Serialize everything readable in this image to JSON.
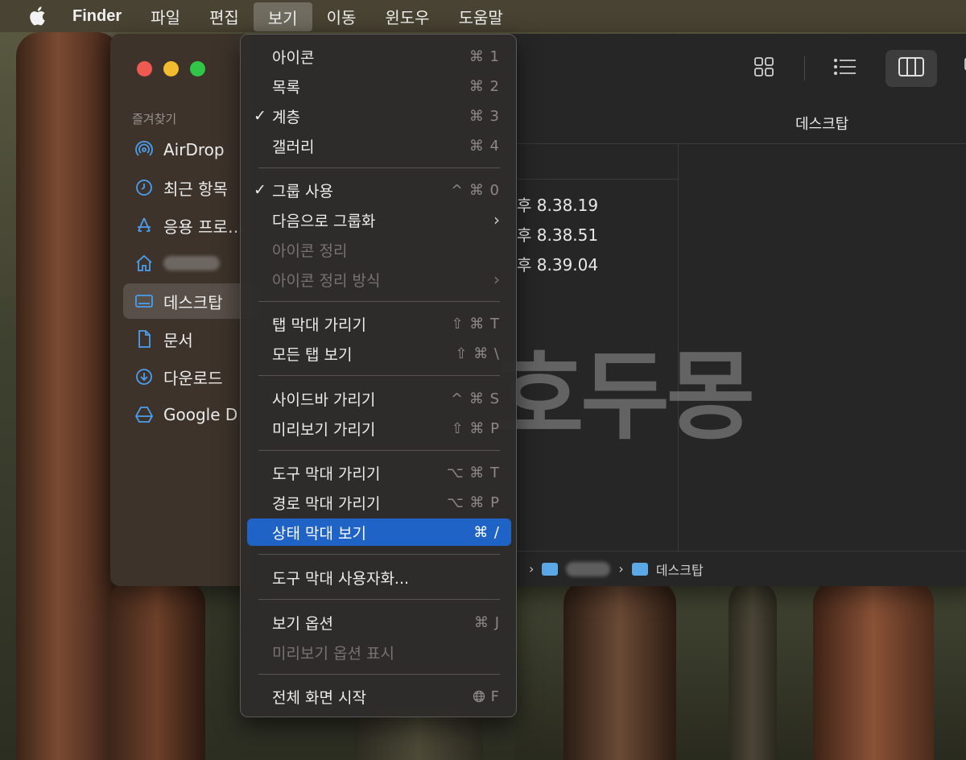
{
  "menubar": {
    "apple_icon": "apple-logo-icon",
    "items": [
      "Finder",
      "파일",
      "편집",
      "보기",
      "이동",
      "윈도우",
      "도움말"
    ]
  },
  "sidebar": {
    "heading": "즐겨찾기",
    "items": [
      {
        "label": "AirDrop",
        "icon": "airdrop-icon"
      },
      {
        "label": "최근 항목",
        "icon": "clock-icon"
      },
      {
        "label": "응용 프로…",
        "icon": "applications-icon"
      },
      {
        "label": "",
        "icon": "home-icon"
      },
      {
        "label": "데스크탑",
        "icon": "desktop-icon"
      },
      {
        "label": "문서",
        "icon": "document-icon"
      },
      {
        "label": "다운로드",
        "icon": "download-icon"
      },
      {
        "label": "Google D",
        "icon": "google-drive-icon"
      }
    ]
  },
  "toolbar": {
    "view_icons": [
      "icon-view-icon",
      "list-view-icon",
      "column-view-icon",
      "gallery-view-icon"
    ]
  },
  "content": {
    "column_title": "데스크탑",
    "files": [
      "후 8.38.19",
      "후 8.38.51",
      "후 8.39.04"
    ],
    "pathbar": [
      "",
      "데스크탑"
    ]
  },
  "watermark": "호두몽",
  "menu": {
    "items": [
      {
        "label": "아이콘",
        "shortcut": "⌘ 1",
        "checked": false
      },
      {
        "label": "목록",
        "shortcut": "⌘ 2",
        "checked": false
      },
      {
        "label": "계층",
        "shortcut": "⌘ 3",
        "checked": true
      },
      {
        "label": "갤러리",
        "shortcut": "⌘ 4",
        "checked": false
      },
      {
        "label": "그룹 사용",
        "shortcut": "^ ⌘ 0",
        "checked": true
      },
      {
        "label": "다음으로 그룹화",
        "shortcut": "",
        "submenu": true
      },
      {
        "label": "아이콘 정리",
        "shortcut": "",
        "disabled": true
      },
      {
        "label": "아이콘 정리 방식",
        "shortcut": "",
        "submenu": true,
        "disabled": true
      },
      {
        "label": "탭 막대 가리기",
        "shortcut": "⇧ ⌘ T"
      },
      {
        "label": "모든 탭 보기",
        "shortcut": "⇧ ⌘ \\"
      },
      {
        "label": "사이드바 가리기",
        "shortcut": "^ ⌘ S"
      },
      {
        "label": "미리보기 가리기",
        "shortcut": "⇧ ⌘ P"
      },
      {
        "label": "도구 막대 가리기",
        "shortcut": "⌥ ⌘ T"
      },
      {
        "label": "경로 막대 가리기",
        "shortcut": "⌥ ⌘ P"
      },
      {
        "label": "상태 막대 보기",
        "shortcut": "⌘ /",
        "highlighted": true
      },
      {
        "label": "도구 막대 사용자화...",
        "shortcut": ""
      },
      {
        "label": "보기 옵션",
        "shortcut": "⌘ J"
      },
      {
        "label": "미리보기 옵션 표시",
        "shortcut": "",
        "disabled": true
      },
      {
        "label": "전체 화면 시작",
        "shortcut": "F",
        "shortcut_icon": "globe-icon"
      }
    ]
  },
  "colors": {
    "highlight": "#1f63c7",
    "accent_icon": "#4a9ff0"
  }
}
